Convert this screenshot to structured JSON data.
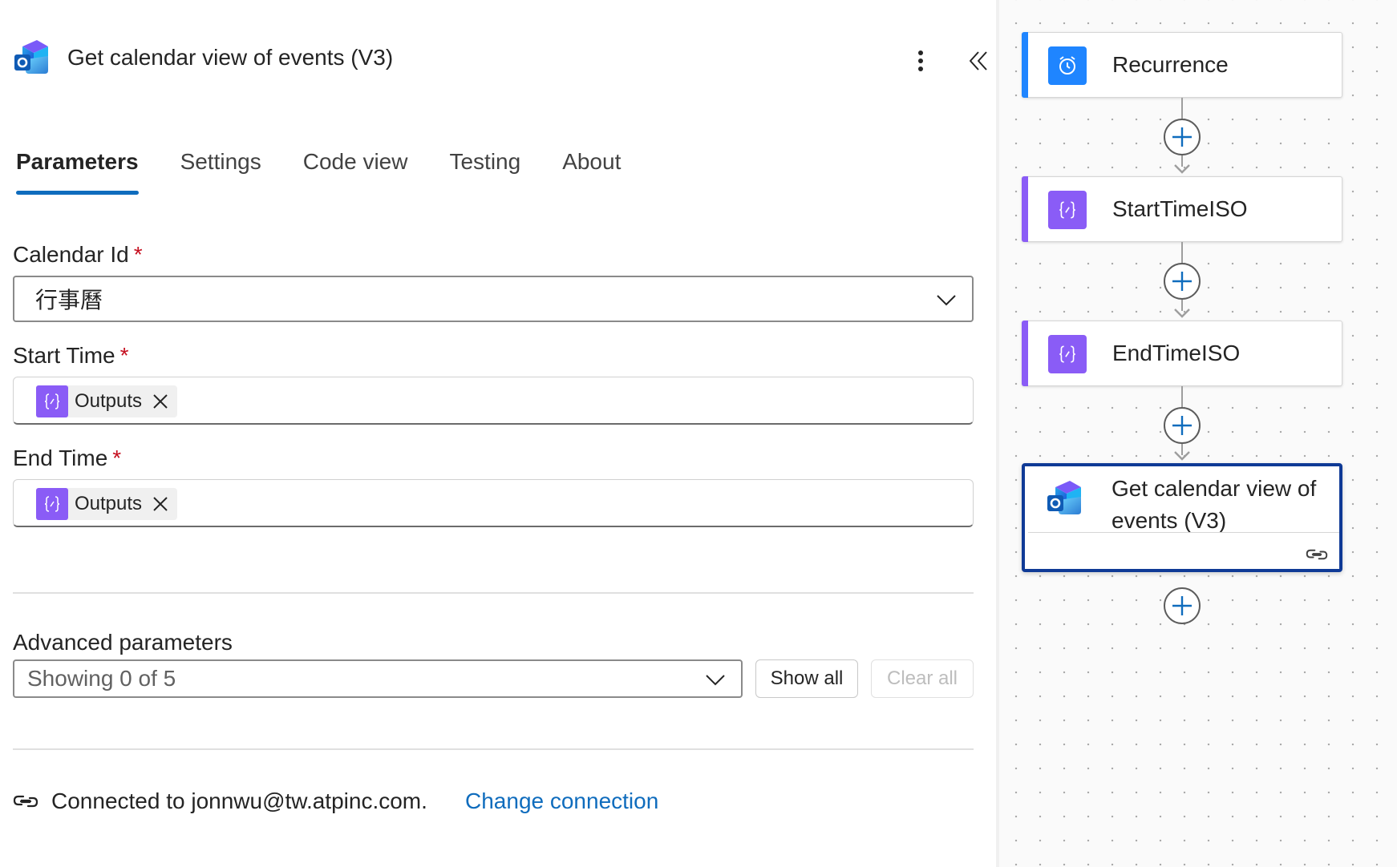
{
  "panel": {
    "title": "Get calendar view of events (V3)",
    "tabs": [
      {
        "label": "Parameters",
        "active": true
      },
      {
        "label": "Settings",
        "active": false
      },
      {
        "label": "Code view",
        "active": false
      },
      {
        "label": "Testing",
        "active": false
      },
      {
        "label": "About",
        "active": false
      }
    ],
    "required_marker": "*",
    "calendar_id": {
      "label": "Calendar Id",
      "value": "行事曆"
    },
    "start_time": {
      "label": "Start Time",
      "token": "Outputs"
    },
    "end_time": {
      "label": "End Time",
      "token": "Outputs"
    },
    "advanced": {
      "label": "Advanced parameters",
      "selected": "Showing 0 of 5",
      "show_all_label": "Show all",
      "clear_all_label": "Clear all"
    },
    "connection": {
      "text": "Connected to jonnwu@tw.atpinc.com.",
      "change_label": "Change connection"
    }
  },
  "canvas": {
    "nodes": [
      {
        "label": "Recurrence",
        "icon": "alarm-clock-icon",
        "color": "#1f85ff"
      },
      {
        "label": "StartTimeISO",
        "icon": "variable-icon",
        "color": "#8a5cf6"
      },
      {
        "label": "EndTimeISO",
        "icon": "variable-icon",
        "color": "#8a5cf6"
      },
      {
        "label": "Get calendar view of events (V3)",
        "icon": "outlook-icon",
        "color": "#0f3a96",
        "selected": true
      }
    ]
  },
  "colors": {
    "accent": "#0f6cbd",
    "required": "#c50f1f",
    "variable": "#8a5cf6",
    "recurrence": "#1f85ff",
    "selected_border": "#0f3a96"
  }
}
